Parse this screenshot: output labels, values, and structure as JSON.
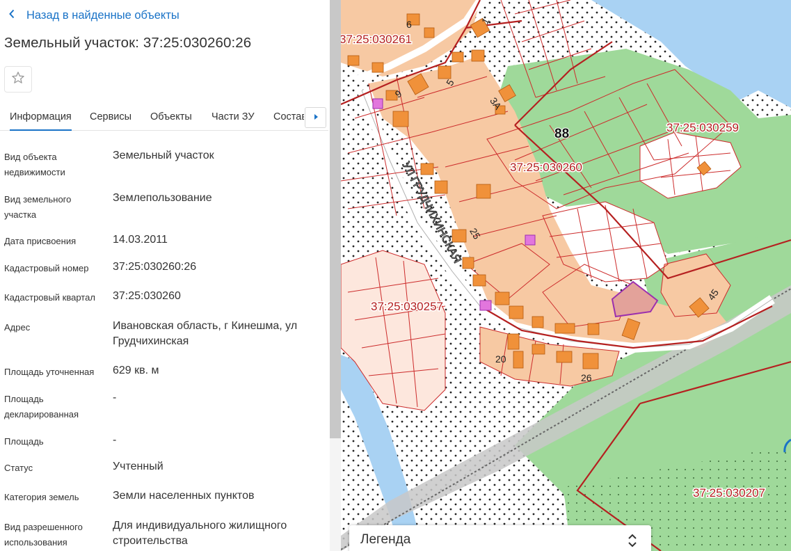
{
  "panel": {
    "back_label": "Назад в найденные объекты",
    "title": "Земельный участок: 37:25:030260:26",
    "tabs": [
      {
        "label": "Информация"
      },
      {
        "label": "Сервисы"
      },
      {
        "label": "Объекты"
      },
      {
        "label": "Части ЗУ"
      },
      {
        "label": "Состав"
      }
    ],
    "fields": [
      {
        "label": "Вид объекта недвижимости",
        "value": "Земельный участок"
      },
      {
        "label": "Вид земельного участка",
        "value": "Землепользование"
      },
      {
        "label": "Дата присвоения",
        "value": "14.03.2011"
      },
      {
        "label": "Кадастровый номер",
        "value": "37:25:030260:26"
      },
      {
        "label": "Кадастровый квартал",
        "value": "37:25:030260"
      },
      {
        "label": "Адрес",
        "value": "Ивановская область, г Кинешма, ул Грудчихинская"
      },
      {
        "label": "Площадь уточненная",
        "value": "629 кв. м"
      },
      {
        "label": "Площадь декларированная",
        "value": "-"
      },
      {
        "label": "Площадь",
        "value": "-"
      },
      {
        "label": "Статус",
        "value": "Учтенный"
      },
      {
        "label": "Категория земель",
        "value": "Земли населенных пунктов"
      },
      {
        "label": "Вид разрешенного использования",
        "value": "Для индивидуального жилищного строительства"
      }
    ]
  },
  "map": {
    "quarter_labels": [
      "37:25:030261",
      "37:25:030259",
      "37:25:030260",
      "37:25:030257",
      "37:25:030207"
    ],
    "street_label": "УЛ ГРУДЧИХИНСКАЯ",
    "house_numbers": [
      "1",
      "6",
      "5",
      "9",
      "3А",
      "25",
      "45",
      "20",
      "26"
    ],
    "parcel_number": "88",
    "legend_label": "Легенда"
  },
  "colors": {
    "accent": "#1a73c7",
    "cadastral_line": "#cc2b2b",
    "parcel_fill": "#f7c9a3",
    "building": "#f0913a",
    "green": "#9fd99a",
    "water": "#a9d2f3",
    "highlight": "#9b2fae"
  }
}
